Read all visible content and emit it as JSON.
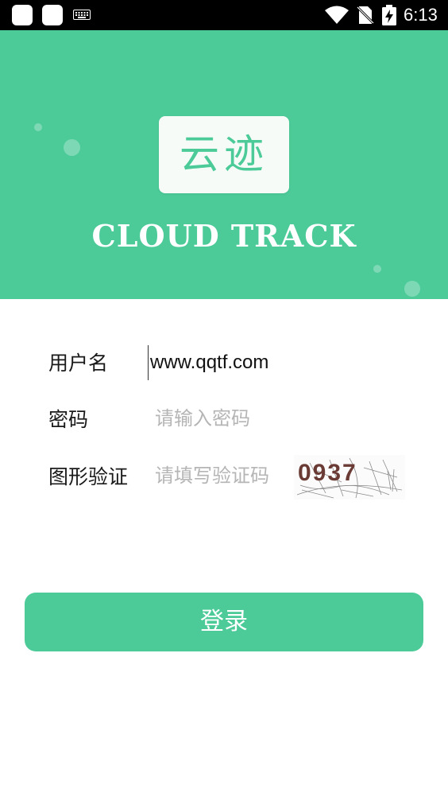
{
  "status_bar": {
    "time": "6:13",
    "icons": [
      "app-icon",
      "app-icon",
      "keyboard-icon",
      "wifi-icon",
      "no-sim-icon",
      "battery-charging-icon"
    ]
  },
  "header": {
    "logo_text": "云迹",
    "brand_name": "CLOUD TRACK"
  },
  "form": {
    "username": {
      "label": "用户名",
      "value": "www.qqtf.com"
    },
    "password": {
      "label": "密码",
      "placeholder": "请输入密码"
    },
    "captcha": {
      "label": "图形验证",
      "placeholder": "请填写验证码",
      "image_text": "0937"
    }
  },
  "login_button": {
    "label": "登录"
  },
  "colors": {
    "brand": "#4ccb99",
    "status_bar": "#000000",
    "text": "#1a1a1a",
    "placeholder": "#b5b5b5"
  }
}
